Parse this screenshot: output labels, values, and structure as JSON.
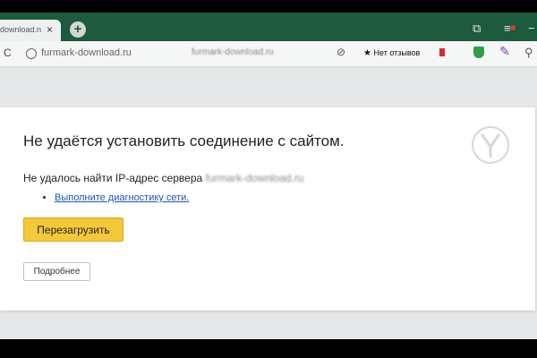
{
  "tab": {
    "title": "download.ru",
    "close": "×"
  },
  "new_tab": "+",
  "window_controls": {
    "copy_icon": "⧉",
    "minimize": "−",
    "ext": "⚙"
  },
  "address": {
    "refresh": "C",
    "url": "furmark-download.ru",
    "page_title_blurred": "furmark-download.ru",
    "zoom_icon": "⊘",
    "reviews_label": "Нет отзывов",
    "star": "★"
  },
  "icons": {
    "pen": "✎",
    "extension": "⚲"
  },
  "error": {
    "heading": "Не удаётся установить соединение с сайтом.",
    "message_prefix": "Не удалось найти IP-адрес сервера ",
    "host": "furmark-download.ru",
    "diagnostics_link": "Выполните диагностику сети",
    "diagnostics_suffix": ".",
    "reload_button": "Перезагрузить",
    "details_button": "Подробнее"
  },
  "colors": {
    "tabstrip": "#1d5a3e",
    "reload_button": "#f5c839",
    "link": "#1a55c4"
  }
}
